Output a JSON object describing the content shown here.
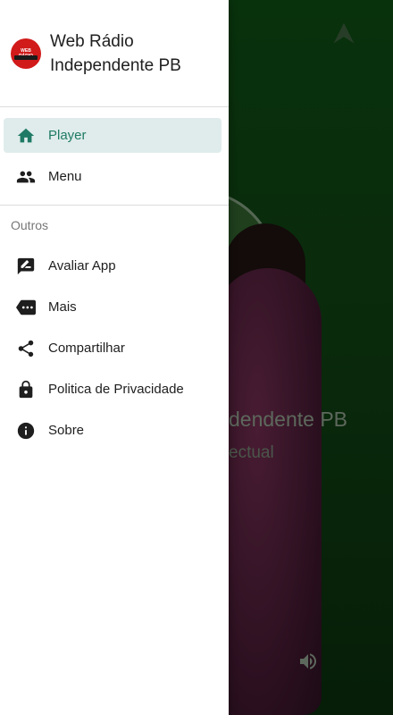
{
  "drawer": {
    "app_title": "Web Rádio Independente PB",
    "logo_text": "WEB RÁDIO",
    "primary_items": [
      {
        "label": "Player",
        "icon": "home-icon",
        "active": true
      },
      {
        "label": "Menu",
        "icon": "people-icon",
        "active": false
      }
    ],
    "section_label": "Outros",
    "secondary_items": [
      {
        "label": "Avaliar App",
        "icon": "rate-review-icon"
      },
      {
        "label": "Mais",
        "icon": "more-tag-icon"
      },
      {
        "label": "Compartilhar",
        "icon": "share-icon"
      },
      {
        "label": "Politica de Privacidade",
        "icon": "lock-icon"
      },
      {
        "label": "Sobre",
        "icon": "info-icon"
      }
    ]
  },
  "background": {
    "station_title_partial": "dendente PB",
    "subtitle_partial": "ectual"
  },
  "colors": {
    "accent": "#1f7a65",
    "active_bg": "#dfeceb",
    "bg_green": "#0d4a12"
  }
}
